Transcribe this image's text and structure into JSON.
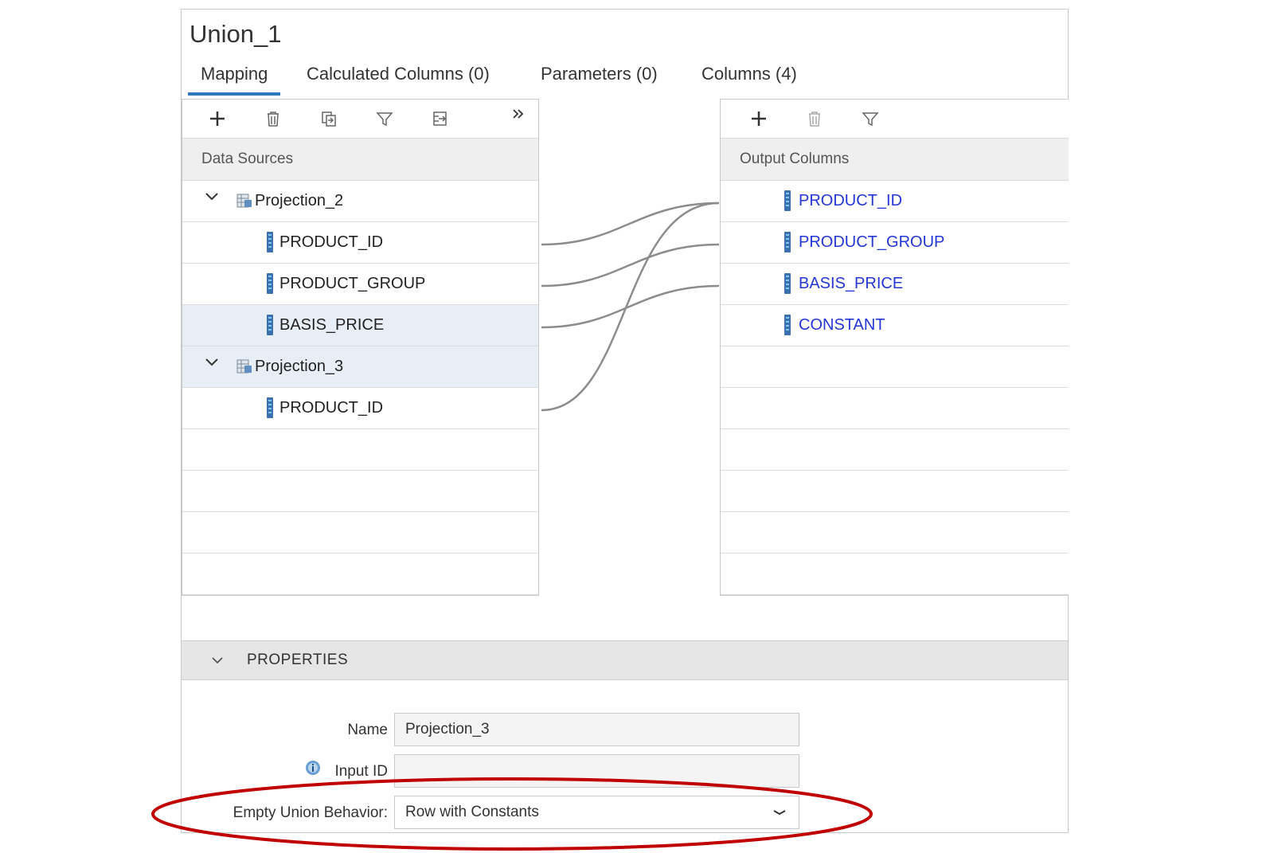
{
  "node": {
    "title": "Union_1"
  },
  "tabs": [
    {
      "label": "Mapping",
      "active": true
    },
    {
      "label": "Calculated Columns (0)",
      "active": false
    },
    {
      "label": "Parameters (0)",
      "active": false
    },
    {
      "label": "Columns (4)",
      "active": false
    }
  ],
  "data_sources": {
    "header": "Data Sources",
    "toolbar": [
      "add-icon",
      "delete-icon",
      "copy-icon",
      "filter-icon",
      "move-icon",
      "more-icon"
    ],
    "sources": [
      {
        "name": "Projection_2",
        "columns": [
          "PRODUCT_ID",
          "PRODUCT_GROUP",
          "BASIS_PRICE"
        ]
      },
      {
        "name": "Projection_3",
        "columns": [
          "PRODUCT_ID"
        ]
      }
    ]
  },
  "output_columns": {
    "header": "Output Columns",
    "toolbar": [
      "add-icon",
      "delete-icon",
      "filter-icon"
    ],
    "columns": [
      "PRODUCT_ID",
      "PRODUCT_GROUP",
      "BASIS_PRICE",
      "CONSTANT"
    ]
  },
  "properties": {
    "title": "PROPERTIES",
    "name_label": "Name",
    "name_value": "Projection_3",
    "input_id_label": "Input ID",
    "input_id_value": "",
    "empty_union_label": "Empty Union Behavior:",
    "empty_union_value": "Row with Constants"
  },
  "colors": {
    "accent": "#2f78b8",
    "output_text": "#2536d6",
    "highlight_ellipse": "#c00000"
  }
}
